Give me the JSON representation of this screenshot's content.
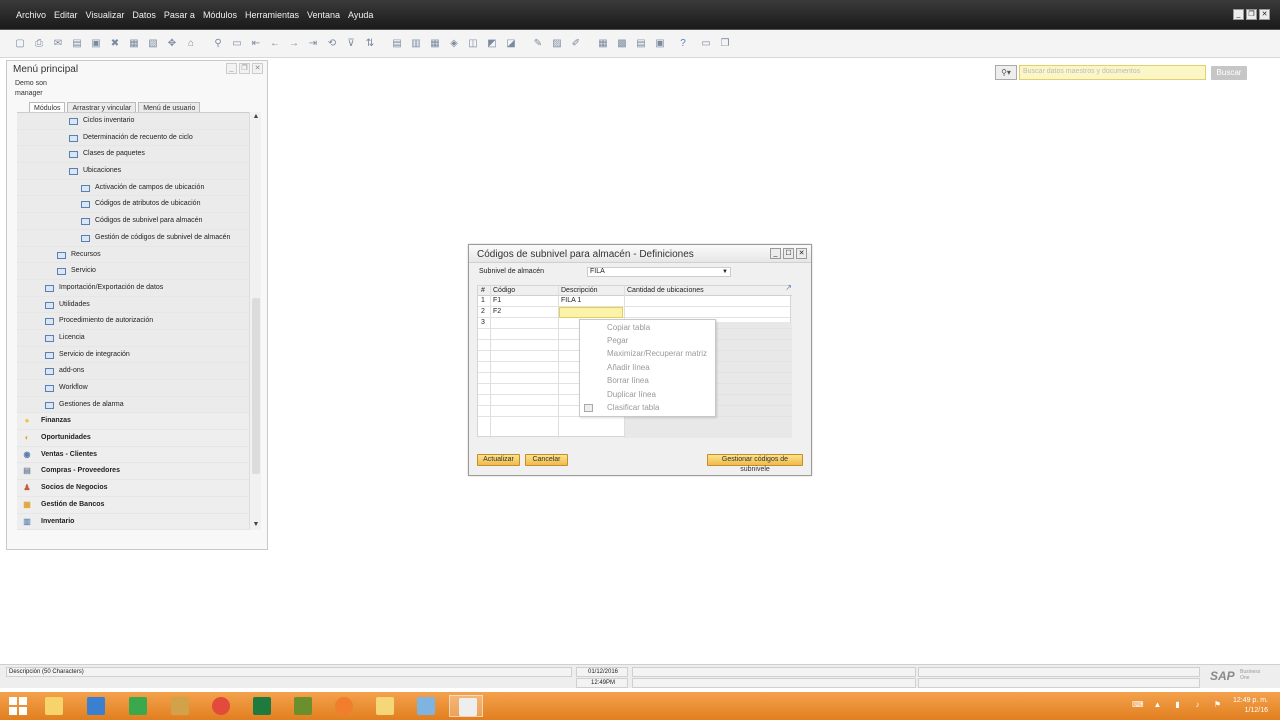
{
  "menubar": {
    "items": [
      "Archivo",
      "Editar",
      "Visualizar",
      "Datos",
      "Pasar a",
      "Módulos",
      "Herramientas",
      "Ventana",
      "Ayuda"
    ]
  },
  "main_menu": {
    "title": "Menú principal",
    "user_line1": "Demo son",
    "user_line2": "manager",
    "tabs": [
      "Módulos",
      "Arrastrar y vincular",
      "Menú de usuario"
    ],
    "tree": [
      {
        "label": "Ciclos inventario",
        "indent": 3
      },
      {
        "label": "Determinación de recuento de ciclo",
        "indent": 3
      },
      {
        "label": "Clases de paquetes",
        "indent": 3
      },
      {
        "label": "Ubicaciones",
        "indent": 3
      },
      {
        "label": "Activación de campos de ubicación",
        "indent": 4
      },
      {
        "label": "Códigos de atributos de ubicación",
        "indent": 4
      },
      {
        "label": "Códigos de subnivel para almacén",
        "indent": 4
      },
      {
        "label": "Gestión de códigos de subnivel de almacén",
        "indent": 4
      },
      {
        "label": "Recursos",
        "indent": 2
      },
      {
        "label": "Servicio",
        "indent": 2
      },
      {
        "label": "Importación/Exportación de datos",
        "indent": 1
      },
      {
        "label": "Utilidades",
        "indent": 1
      },
      {
        "label": "Procedimiento de autorización",
        "indent": 1
      },
      {
        "label": "Licencia",
        "indent": 1
      },
      {
        "label": "Servicio de integración",
        "indent": 1
      },
      {
        "label": "add-ons",
        "indent": 1
      },
      {
        "label": "Workflow",
        "indent": 1
      },
      {
        "label": "Gestiones de alarma",
        "indent": 1
      }
    ],
    "modules": [
      {
        "label": "Finanzas",
        "icon": "finance-icon"
      },
      {
        "label": "Oportunidades",
        "icon": "opportunities-icon"
      },
      {
        "label": "Ventas - Clientes",
        "icon": "sales-icon"
      },
      {
        "label": "Compras - Proveedores",
        "icon": "purchasing-icon"
      },
      {
        "label": "Socios de Negocios",
        "icon": "business-partners-icon"
      },
      {
        "label": "Gestión de Bancos",
        "icon": "banking-icon"
      },
      {
        "label": "Inventario",
        "icon": "inventory-icon"
      }
    ]
  },
  "search": {
    "placeholder": "Buscar datos maestros y documentos",
    "button_label": "Buscar"
  },
  "dialog": {
    "title": "Códigos de subnivel para almacén - Definiciones",
    "field_label": "Subnivel de almacén",
    "field_value": "FILA",
    "columns": [
      "#",
      "Código",
      "Descripción",
      "Cantidad de ubicaciones"
    ],
    "rows": [
      {
        "num": "1",
        "code": "F1",
        "desc": "FILA 1"
      },
      {
        "num": "2",
        "code": "F2",
        "desc": ""
      },
      {
        "num": "3",
        "code": "",
        "desc": ""
      }
    ],
    "update_button": "Actualizar",
    "cancel_button": "Cancelar",
    "manage_button": "Gestionar códigos de subnivele"
  },
  "context_menu": {
    "items": [
      "Copiar tabla",
      "Pegar",
      "Maximizar/Recuperar matriz",
      "Añadir línea",
      "Borrar línea",
      "Duplicar línea",
      "Clasificar tabla"
    ]
  },
  "status": {
    "field_info": "Descripción (50 Characters)",
    "date": "01/12/2016",
    "time": "12:49PM",
    "brand": "SAP",
    "brand_sub1": "Business",
    "brand_sub2": "One"
  },
  "taskbar": {
    "clock_time": "12:49 p. m.",
    "clock_date": "1/12/16"
  },
  "colors": {
    "accent_gold": "#f0b94d",
    "taskbar_orange": "#e98a2a",
    "edit_yellow": "#fdf3a8"
  }
}
